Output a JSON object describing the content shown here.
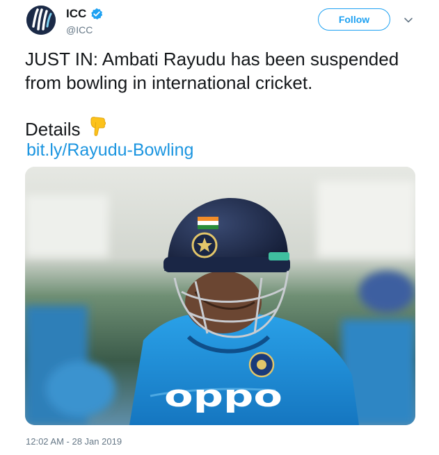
{
  "account": {
    "name": "ICC",
    "handle": "@ICC",
    "avatar_icon": "icc-logo-icon",
    "verified_icon": "verified-badge-icon"
  },
  "actions": {
    "follow_label": "Follow",
    "more_icon": "chevron-down-icon"
  },
  "tweet": {
    "text": "JUST IN: Ambati Rayudu has been suspended from bowling in international cricket.",
    "details_label": "Details",
    "details_icon": "pointing-down-emoji",
    "link": "bit.ly/Rayudu-Bowling",
    "media_alt": "Cricketer in blue helmet and Oppo jersey looking down",
    "jersey_text": "oppo",
    "timestamp": "12:02 AM - 28 Jan 2019"
  },
  "colors": {
    "twitter_blue": "#1da1f2",
    "link_blue": "#1b95e0",
    "secondary_text": "#657786",
    "jersey_blue": "#1f8fd8",
    "helmet_navy": "#1e2a4a"
  }
}
